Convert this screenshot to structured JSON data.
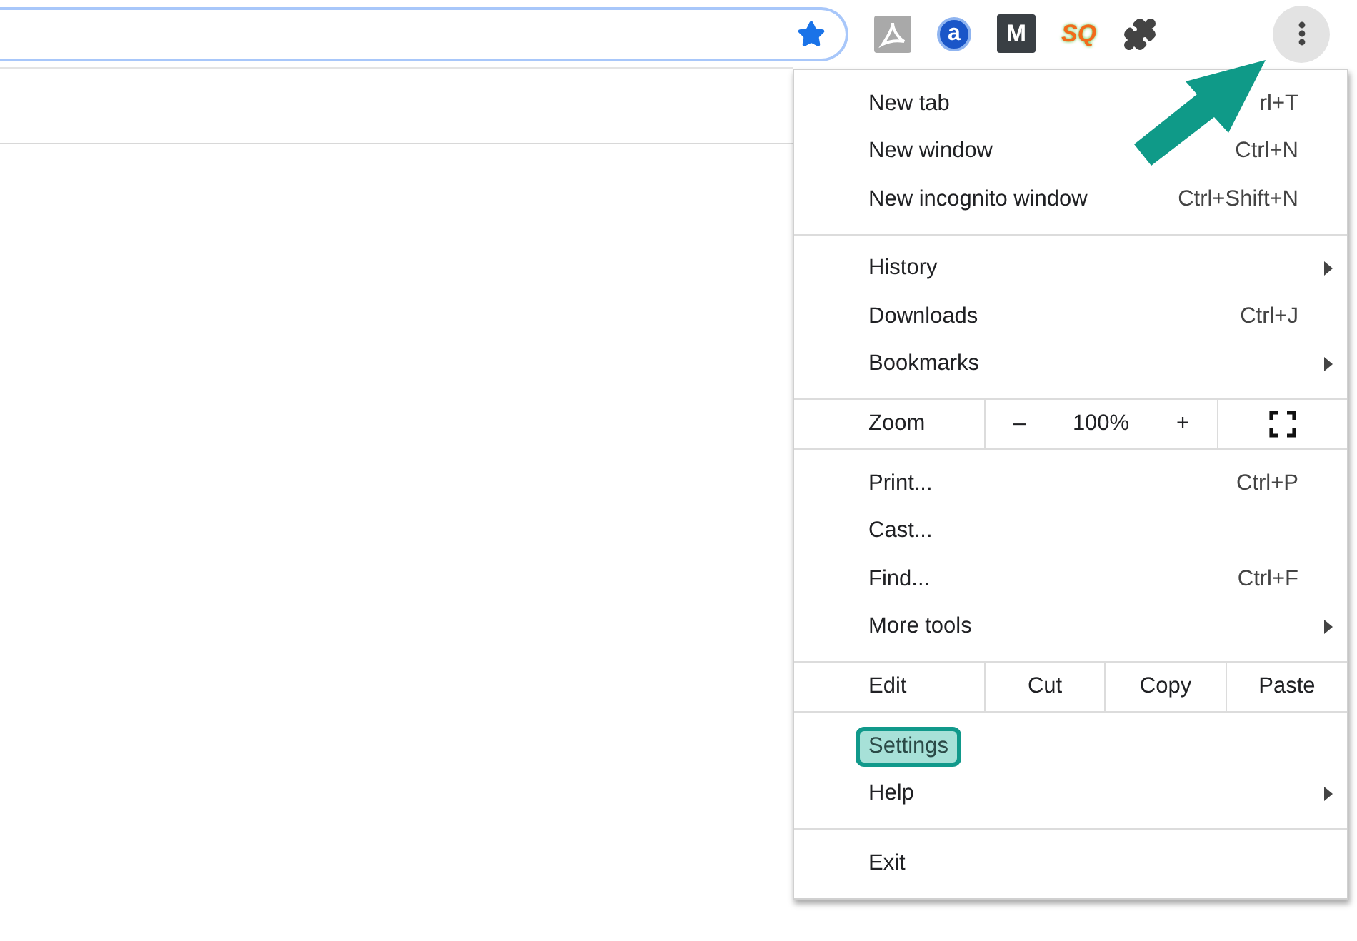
{
  "toolbar": {
    "bookmarked": true,
    "extensions": [
      {
        "kind": "pdf"
      },
      {
        "kind": "circle",
        "glyph": "a"
      },
      {
        "kind": "square",
        "glyph": "M"
      },
      {
        "kind": "splash",
        "glyph": "SQ"
      },
      {
        "kind": "puzzle"
      }
    ],
    "menu_button": {
      "pressed": true
    }
  },
  "menu": {
    "sections": [
      {
        "items": [
          {
            "kind": "item",
            "label": "New tab",
            "shortcut": "rl+T"
          },
          {
            "kind": "item",
            "label": "New window",
            "shortcut": "Ctrl+N"
          },
          {
            "kind": "item",
            "label": "New incognito window",
            "shortcut": "Ctrl+Shift+N"
          }
        ]
      },
      {
        "items": [
          {
            "kind": "item",
            "label": "History",
            "submenu": true
          },
          {
            "kind": "item",
            "label": "Downloads",
            "shortcut": "Ctrl+J"
          },
          {
            "kind": "item",
            "label": "Bookmarks",
            "submenu": true
          }
        ]
      },
      {
        "items": [
          {
            "kind": "zoom",
            "label": "Zoom",
            "minus": "–",
            "value": "100%",
            "plus": "+"
          }
        ]
      },
      {
        "items": [
          {
            "kind": "item",
            "label": "Print...",
            "shortcut": "Ctrl+P"
          },
          {
            "kind": "item",
            "label": "Cast..."
          },
          {
            "kind": "item",
            "label": "Find...",
            "shortcut": "Ctrl+F"
          },
          {
            "kind": "item",
            "label": "More tools",
            "submenu": true
          }
        ]
      },
      {
        "items": [
          {
            "kind": "edit",
            "label": "Edit",
            "buttons": [
              "Cut",
              "Copy",
              "Paste"
            ]
          }
        ]
      },
      {
        "items": [
          {
            "kind": "item",
            "label": "Settings",
            "highlighted": true
          },
          {
            "kind": "item",
            "label": "Help",
            "submenu": true
          }
        ]
      },
      {
        "items": [
          {
            "kind": "item",
            "label": "Exit"
          }
        ]
      }
    ]
  },
  "annotation": {
    "kind": "arrow"
  }
}
